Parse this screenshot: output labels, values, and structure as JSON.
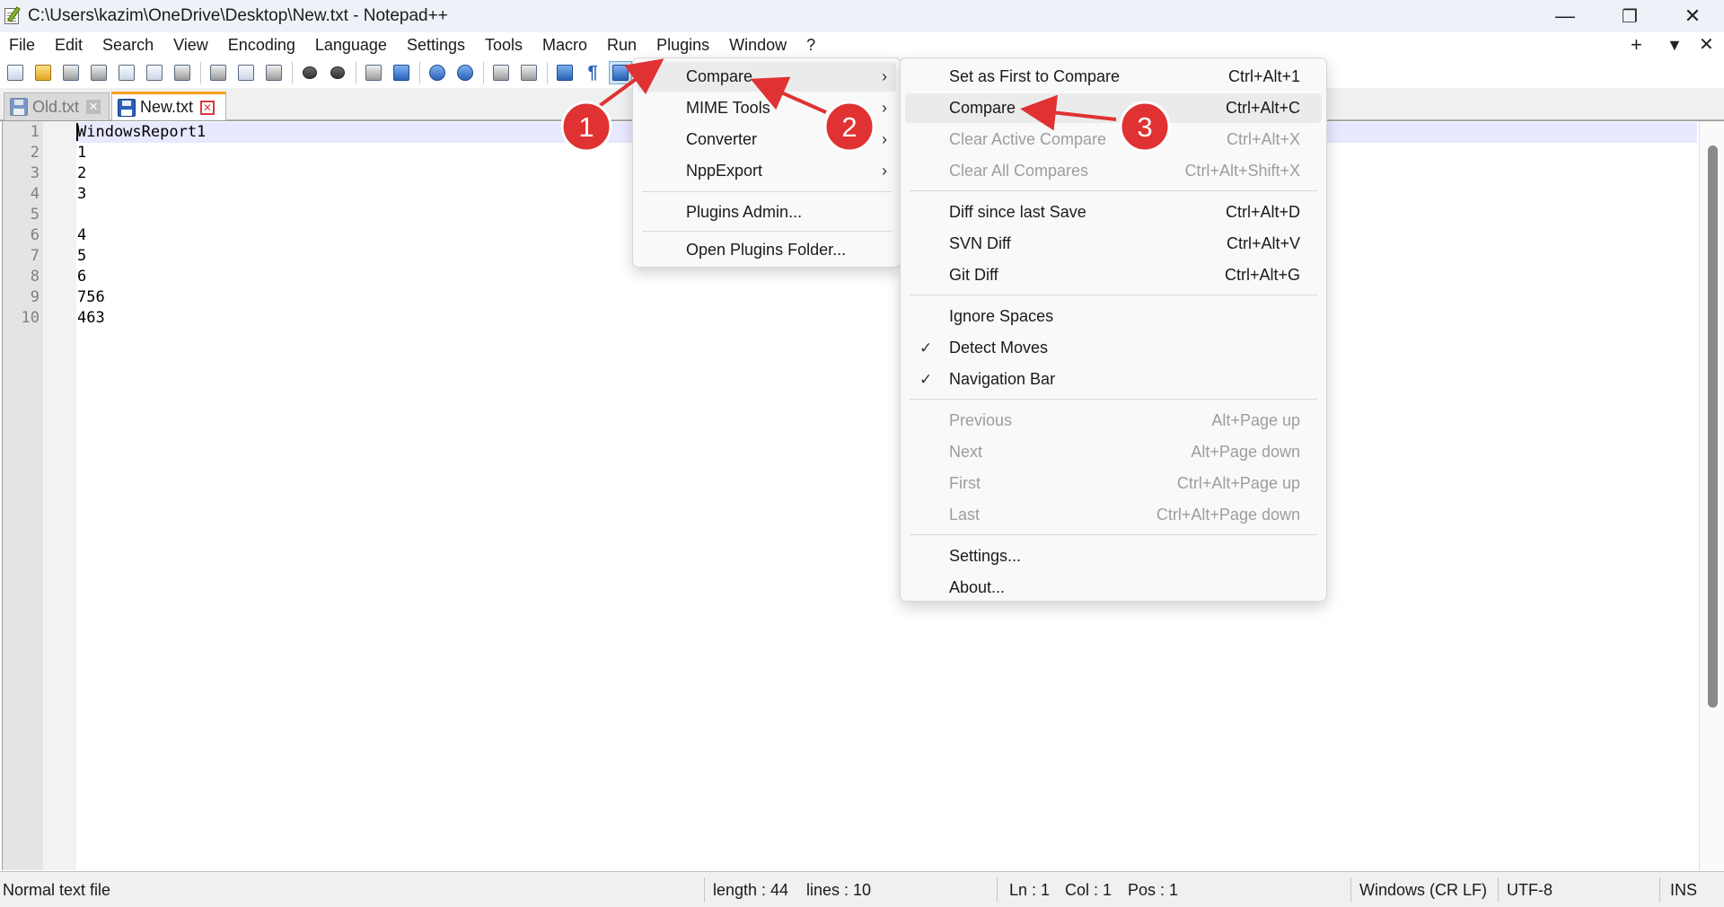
{
  "window": {
    "title": "C:\\Users\\kazim\\OneDrive\\Desktop\\New.txt - Notepad++",
    "controls": {
      "minimize": "—",
      "maximize": "❐",
      "close": "✕"
    }
  },
  "menubar": {
    "items": [
      "File",
      "Edit",
      "Search",
      "View",
      "Encoding",
      "Language",
      "Settings",
      "Tools",
      "Macro",
      "Run",
      "Plugins",
      "Window",
      "?"
    ],
    "right": {
      "add": "+",
      "dropdown": "▼",
      "close": "✕"
    }
  },
  "tabs": [
    {
      "label": "Old.txt",
      "active": false,
      "close": "✕"
    },
    {
      "label": "New.txt",
      "active": true,
      "close": "✕"
    }
  ],
  "editor": {
    "lines": [
      {
        "num": "1",
        "text": "WindowsReport1"
      },
      {
        "num": "2",
        "text": "1"
      },
      {
        "num": "3",
        "text": "2"
      },
      {
        "num": "4",
        "text": "3"
      },
      {
        "num": "5",
        "text": ""
      },
      {
        "num": "6",
        "text": "4"
      },
      {
        "num": "7",
        "text": "5"
      },
      {
        "num": "8",
        "text": "6"
      },
      {
        "num": "9",
        "text": "756"
      },
      {
        "num": "10",
        "text": "463"
      }
    ]
  },
  "statusbar": {
    "file_type": "Normal text file",
    "length": "length : 44",
    "lines": "lines : 10",
    "ln": "Ln : 1",
    "col": "Col : 1",
    "pos": "Pos : 1",
    "eol": "Windows (CR LF)",
    "encoding": "UTF-8",
    "mode": "INS"
  },
  "plugins_menu": {
    "items": [
      "Compare",
      "MIME Tools",
      "Converter",
      "NppExport",
      "Plugins Admin...",
      "Open Plugins Folder..."
    ],
    "arrow": "›"
  },
  "compare_menu": {
    "set_first": {
      "label": "Set as First to Compare",
      "shortcut": "Ctrl+Alt+1"
    },
    "compare": {
      "label": "Compare",
      "shortcut": "Ctrl+Alt+C"
    },
    "clear_active": {
      "label": "Clear Active Compare",
      "shortcut": "Ctrl+Alt+X"
    },
    "clear_all": {
      "label": "Clear All Compares",
      "shortcut": "Ctrl+Alt+Shift+X"
    },
    "diff_save": {
      "label": "Diff since last Save",
      "shortcut": "Ctrl+Alt+D"
    },
    "svn_diff": {
      "label": "SVN Diff",
      "shortcut": "Ctrl+Alt+V"
    },
    "git_diff": {
      "label": "Git Diff",
      "shortcut": "Ctrl+Alt+G"
    },
    "ignore_spaces": {
      "label": "Ignore Spaces"
    },
    "detect_moves": {
      "label": "Detect Moves",
      "check": "✓"
    },
    "nav_bar": {
      "label": "Navigation Bar",
      "check": "✓"
    },
    "previous": {
      "label": "Previous",
      "shortcut": "Alt+Page up"
    },
    "next": {
      "label": "Next",
      "shortcut": "Alt+Page down"
    },
    "first": {
      "label": "First",
      "shortcut": "Ctrl+Alt+Page up"
    },
    "last": {
      "label": "Last",
      "shortcut": "Ctrl+Alt+Page down"
    },
    "settings": {
      "label": "Settings..."
    },
    "about": {
      "label": "About..."
    }
  },
  "annotations": {
    "step1": "1",
    "step2": "2",
    "step3": "3",
    "color": "#e03232"
  }
}
